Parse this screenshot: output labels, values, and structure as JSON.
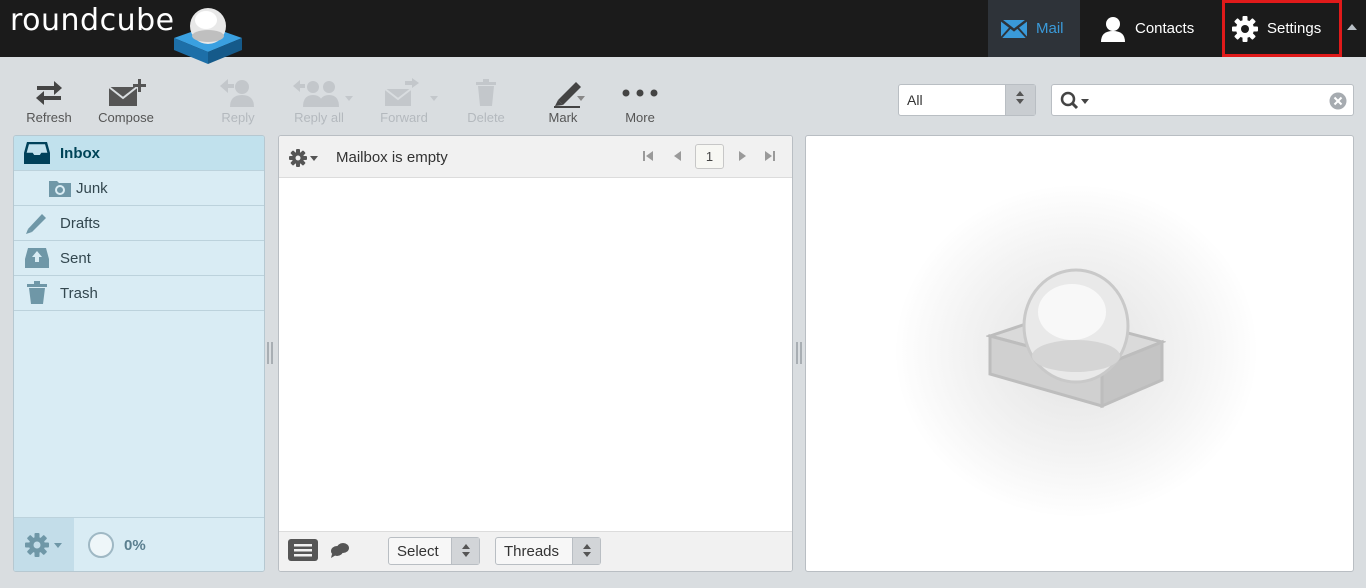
{
  "app": {
    "logo_text": "roundcube"
  },
  "nav": {
    "mail": "Mail",
    "contacts": "Contacts",
    "settings": "Settings"
  },
  "toolbar": {
    "refresh": "Refresh",
    "compose": "Compose",
    "reply": "Reply",
    "reply_all": "Reply all",
    "forward": "Forward",
    "delete": "Delete",
    "mark": "Mark",
    "more": "More"
  },
  "filter": {
    "selected": "All"
  },
  "search": {
    "value": "",
    "placeholder": ""
  },
  "folders": [
    {
      "label": "Inbox",
      "icon": "inbox-icon",
      "selected": true
    },
    {
      "label": "Junk",
      "icon": "junk-icon",
      "selected": false
    },
    {
      "label": "Drafts",
      "icon": "drafts-icon",
      "selected": false
    },
    {
      "label": "Sent",
      "icon": "sent-icon",
      "selected": false
    },
    {
      "label": "Trash",
      "icon": "trash-icon",
      "selected": false
    }
  ],
  "quota": {
    "text": "0%"
  },
  "message_list": {
    "status": "Mailbox is empty",
    "page": "1",
    "select_label": "Select",
    "threads_label": "Threads"
  },
  "colors": {
    "topbar": "#1b1b1b",
    "accent": "#3a9ad9",
    "highlight_border": "#e01a1a",
    "folder_bg": "#d9ecf4"
  }
}
